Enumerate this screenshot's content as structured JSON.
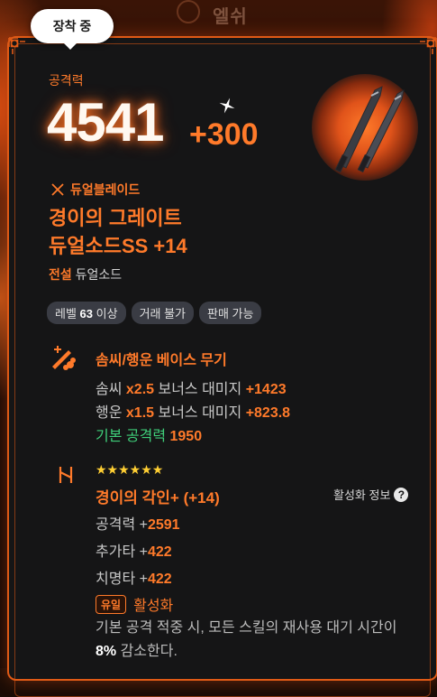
{
  "background": {
    "text": "엘쉬"
  },
  "badge": {
    "label": "장착 중"
  },
  "attack": {
    "label": "공격력",
    "value": "4541",
    "bonus": "+300"
  },
  "item": {
    "type": "듀얼블레이드",
    "name_line1": "경이의 그레이트",
    "name_line2": "듀얼소드SS +14",
    "grade": "전설",
    "class_name": "듀얼소드"
  },
  "tags": [
    {
      "prefix": "레벨 ",
      "strong": "63",
      "suffix": " 이상"
    },
    {
      "prefix": "거래 불가",
      "strong": "",
      "suffix": ""
    },
    {
      "prefix": "판매 가능",
      "strong": "",
      "suffix": ""
    }
  ],
  "base_section": {
    "title": "솜씨/행운 베이스 무기",
    "lines": [
      {
        "label": "솜씨 ",
        "mult": "x2.5",
        "mid": " 보너스 대미지 ",
        "value": "+1423"
      },
      {
        "label": "행운 ",
        "mult": "x1.5",
        "mid": " 보너스 대미지 ",
        "value": "+823.8"
      }
    ],
    "base_attack": {
      "label": "기본 공격력 ",
      "value": "1950"
    }
  },
  "engrave": {
    "stars": "★★★★★★",
    "title": "경이의 각인+ (+14)",
    "info_label": "활성화 정보",
    "info_icon": "help-icon",
    "stats": [
      {
        "label": "공격력 +",
        "value": "2591"
      },
      {
        "label": "추가타 +",
        "value": "422"
      },
      {
        "label": "치명타 +",
        "value": "422"
      }
    ],
    "unique_badge": "유일",
    "unique_state": "활성화",
    "desc_before": "기본 공격 적중 시, 모든 스킬의 재사용 대기 시간이 ",
    "desc_pct": "8%",
    "desc_after": " 감소한다."
  },
  "colors": {
    "accent": "#ff7a2a",
    "border": "#e05a16",
    "panel": "#151516",
    "green": "#3fcf7a",
    "star": "#ffcf33"
  }
}
